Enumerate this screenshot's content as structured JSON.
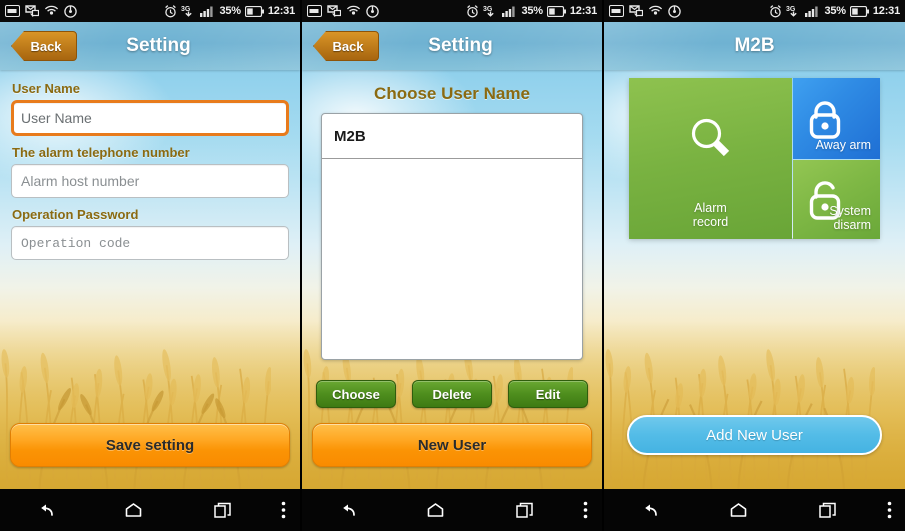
{
  "status_bar": {
    "icons_left": [
      "sim-card-icon",
      "message-icon",
      "wifi-signal-icon",
      "sync-circle-icon"
    ],
    "icons_right": [
      "alarm-clock-icon",
      "3g-download-icon",
      "signal-bars-icon"
    ],
    "battery_percent": "35%",
    "battery_icon": "battery-icon",
    "time": "12:31"
  },
  "colors": {
    "accent_orange": "#f98b00",
    "accent_green": "#4f8f1e",
    "accent_blue": "#45b3e2",
    "header_blue": "#6fb2d2",
    "label_olive": "#8a6a12",
    "focus_border": "#e87b1c"
  },
  "nav_bar": {
    "back": "back-nav-icon",
    "home": "home-nav-icon",
    "recents": "recents-nav-icon",
    "menu": "overflow-menu-icon"
  },
  "panel_settings": {
    "back_label": "Back",
    "title": "Setting",
    "fields": [
      {
        "label": "User Name",
        "value": "",
        "placeholder": "User Name",
        "focused": true,
        "mono": false
      },
      {
        "label": "The alarm telephone number",
        "value": "",
        "placeholder": "Alarm host number",
        "focused": false,
        "mono": false
      },
      {
        "label": "Operation Password",
        "value": "",
        "placeholder": "Operation code",
        "focused": false,
        "mono": true
      }
    ],
    "save_label": "Save setting"
  },
  "panel_choose_user": {
    "back_label": "Back",
    "title": "Setting",
    "section_title": "Choose User Name",
    "users": [
      "M2B"
    ],
    "actions": [
      {
        "label": "Choose"
      },
      {
        "label": "Delete"
      },
      {
        "label": "Edit"
      }
    ],
    "new_user_label": "New User"
  },
  "panel_dashboard": {
    "title": "M2B",
    "tiles": [
      {
        "label": "Away arm",
        "icon": "lock-closed-icon",
        "color": "#2f8be4"
      },
      {
        "label": "System disarm",
        "icon": "lock-open-icon",
        "color": "#7fb845"
      },
      {
        "label": "Alarm\nrecord",
        "label_line1": "Alarm",
        "label_line2": "record",
        "icon": "magnifier-icon",
        "color": "#79b241"
      }
    ],
    "add_user_label": "Add New User"
  }
}
